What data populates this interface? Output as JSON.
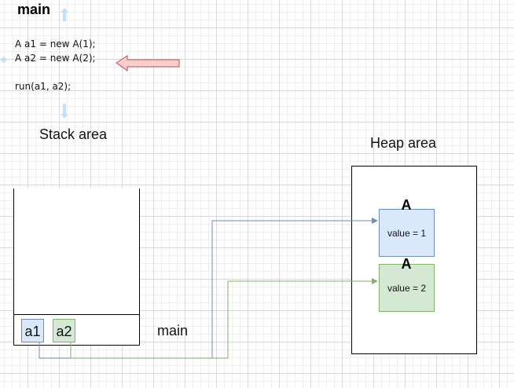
{
  "title": "main",
  "code": {
    "line1": {
      "prefix": "A a1 = new A(",
      "value": "1",
      "suffix": ");"
    },
    "line2": {
      "prefix": "A a2 = new A(",
      "value": "2",
      "suffix": ");"
    },
    "line3": "run(a1, a2);"
  },
  "stack": {
    "title": "Stack area",
    "frame_label": "main",
    "vars": [
      "a1",
      "a2"
    ]
  },
  "heap": {
    "title": "Heap area",
    "objects": [
      {
        "class": "A",
        "label": "value = 1"
      },
      {
        "class": "A",
        "label": "value = 2"
      }
    ]
  },
  "colors": {
    "blue_fill": "#dae8fc",
    "blue_stroke": "#6c8ebf",
    "green_fill": "#d5e8d4",
    "green_stroke": "#82b366",
    "arrow_fill": "#f8cecc",
    "arrow_stroke": "#b85450",
    "handle": "#b3d9ff"
  }
}
